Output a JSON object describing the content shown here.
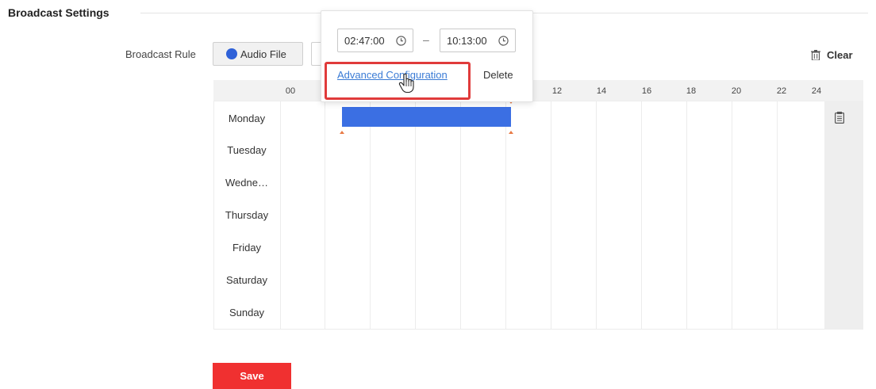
{
  "section": {
    "title": "Broadcast Settings"
  },
  "rule": {
    "label": "Broadcast Rule",
    "audio_file_label": "Audio File"
  },
  "toolbar": {
    "clear_label": "Clear"
  },
  "schedule": {
    "hours": [
      "00",
      "12",
      "14",
      "16",
      "18",
      "20",
      "22",
      "24"
    ],
    "days": [
      "Monday",
      "Tuesday",
      "Wedne…",
      "Thursday",
      "Friday",
      "Saturday",
      "Sunday"
    ],
    "bar": {
      "day": "Monday",
      "start": "02:47:00",
      "end": "10:13:00",
      "color": "#3b6fe3"
    }
  },
  "popup": {
    "start_time": "02:47:00",
    "end_time": "10:13:00",
    "separator": "–",
    "advanced_label": "Advanced Configuration",
    "delete_label": "Delete"
  },
  "actions": {
    "save_label": "Save"
  },
  "colors": {
    "accent": "#f03030",
    "bar": "#3b6fe3",
    "link": "#3a7bd5",
    "highlight": "#e03b3b"
  }
}
